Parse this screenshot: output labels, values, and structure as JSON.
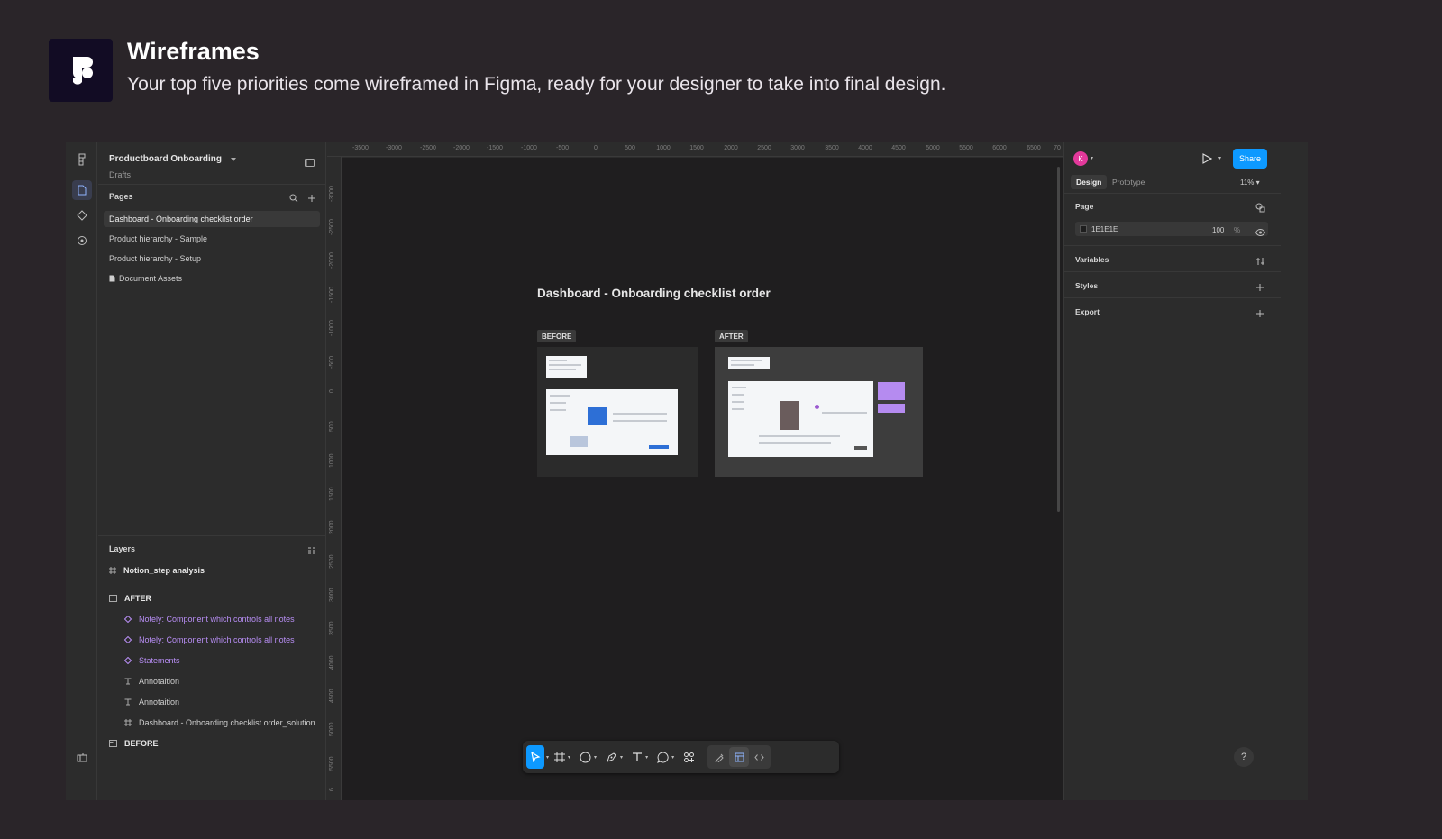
{
  "promo": {
    "title": "Wireframes",
    "subtitle": "Your top five priorities come wireframed in Figma, ready for your designer to take into final design."
  },
  "file": {
    "name": "Productboard Onboarding",
    "location": "Drafts"
  },
  "pages": {
    "header": "Pages",
    "items": [
      {
        "label": "Dashboard - Onboarding checklist order",
        "selected": true
      },
      {
        "label": "Product hierarchy - Sample",
        "selected": false
      },
      {
        "label": "Product hierarchy - Setup",
        "selected": false
      },
      {
        "label": "Document Assets",
        "selected": false
      }
    ]
  },
  "layers": {
    "header": "Layers",
    "items": [
      {
        "label": "Notion_step analysis",
        "type": "frame"
      },
      {
        "label": "AFTER",
        "type": "section"
      },
      {
        "label": "Notely: Component which controls all notes",
        "type": "component"
      },
      {
        "label": "Notely: Component which controls all notes",
        "type": "component"
      },
      {
        "label": "Statements",
        "type": "component"
      },
      {
        "label": "Annotaition",
        "type": "text"
      },
      {
        "label": "Annotaition",
        "type": "text"
      },
      {
        "label": "Dashboard - Onboarding checklist order_solution",
        "type": "frame"
      },
      {
        "label": "BEFORE",
        "type": "section"
      }
    ]
  },
  "rulers": {
    "top": [
      "-3500",
      "-3000",
      "-2500",
      "-2000",
      "-1500",
      "-1000",
      "-500",
      "0",
      "500",
      "1000",
      "1500",
      "2000",
      "2500",
      "3000",
      "3500",
      "4000",
      "4500",
      "5000",
      "5500",
      "6000",
      "6500",
      "70"
    ],
    "left": [
      "-3000",
      "-2500",
      "-2000",
      "-1500",
      "-1000",
      "-500",
      "0",
      "500",
      "1000",
      "1500",
      "2000",
      "2500",
      "3000",
      "3500",
      "4000",
      "4500",
      "5000",
      "5500",
      "6"
    ]
  },
  "canvas": {
    "title": "Dashboard - Onboarding checklist order",
    "before_label": "BEFORE",
    "after_label": "AFTER"
  },
  "right_panel": {
    "avatar_initial": "K",
    "share_label": "Share",
    "tabs": [
      "Design",
      "Prototype"
    ],
    "zoom": "11%",
    "page_section": "Page",
    "page_color": "1E1E1E",
    "page_opacity": "100",
    "percent_sign": "%",
    "variables": "Variables",
    "styles": "Styles",
    "export": "Export",
    "help": "?"
  },
  "colors": {
    "background": "#2a2529",
    "accent": "#0d99ff",
    "component": "#b88ef5",
    "avatar": "#e3399b"
  }
}
